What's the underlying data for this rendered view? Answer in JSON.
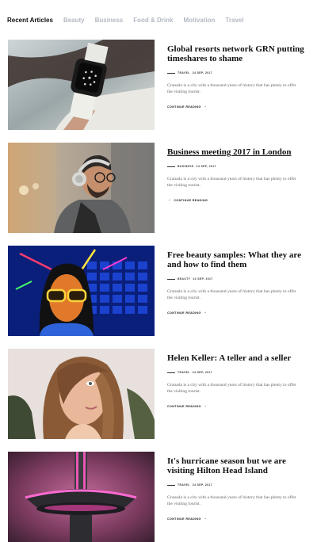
{
  "tabs": [
    {
      "label": "Recent Articles",
      "active": true
    },
    {
      "label": "Beauty",
      "active": false
    },
    {
      "label": "Business",
      "active": false
    },
    {
      "label": "Food & Drink",
      "active": false
    },
    {
      "label": "Motivation",
      "active": false
    },
    {
      "label": "Travel",
      "active": false
    }
  ],
  "articles": [
    {
      "title": "Global resorts network GRN putting timeshares to shame",
      "category": "Travel",
      "date": "24 Sep, 2017",
      "excerpt": "Granada is a city with a thousand years of history that has plenty to offer the visiting tourist.",
      "cta": "Continue reading",
      "image": "smartwatch-wrist-photo"
    },
    {
      "title": "Business meeting 2017 in London",
      "category": "Business",
      "date": "24 Sep, 2017",
      "excerpt": "Granada is a city with a thousand years of history that has plenty to offer the visiting tourist.",
      "cta": "Continue reading",
      "image": "man-headphones-photo"
    },
    {
      "title": "Free beauty samples: What they are and how to find them",
      "category": "Beauty",
      "date": "24 Sep, 2017",
      "excerpt": "Granada is a city with a thousand years of history that has plenty to offer the visiting tourist.",
      "cta": "Continue reading",
      "image": "neon-glasses-photo"
    },
    {
      "title": "Helen Keller: A teller and a seller",
      "category": "Travel",
      "date": "24 Sep, 2017",
      "excerpt": "Granada is a city with a thousand years of history that has plenty to offer the visiting tourist.",
      "cta": "Continue reading",
      "image": "woman-portrait-photo"
    },
    {
      "title": "It's hurricane season but we are visiting Hilton Head Island",
      "category": "Travel",
      "date": "24 Sep, 2017",
      "excerpt": "Granada is a city with a thousand years of history that has plenty to offer the visiting tourist.",
      "cta": "Continue reading",
      "image": "observation-tower-photo"
    }
  ]
}
